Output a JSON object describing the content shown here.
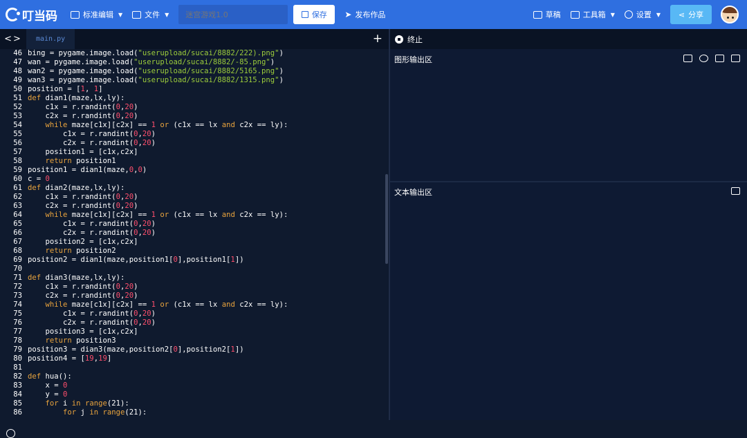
{
  "topbar": {
    "logo": "叮当码",
    "mode_menu": "标准编辑",
    "file_menu": "文件",
    "title_placeholder": "迷宫游戏1.0",
    "save": "保存",
    "publish": "发布作品",
    "draft": "草稿",
    "toolbox": "工具箱",
    "settings": "设置",
    "share": "分享"
  },
  "editor": {
    "tab": "main.py",
    "lines": [
      [
        {
          "t": "bing = pygame.image.load(",
          "c": ""
        },
        {
          "t": "\"userupload/sucai/8882/222).png\"",
          "c": "str"
        },
        {
          "t": ")",
          "c": ""
        }
      ],
      [
        {
          "t": "wan = pygame.image.load(",
          "c": ""
        },
        {
          "t": "\"userupload/sucai/8882/-85.png\"",
          "c": "str"
        },
        {
          "t": ")",
          "c": ""
        }
      ],
      [
        {
          "t": "wan2 = pygame.image.load(",
          "c": ""
        },
        {
          "t": "\"userupload/sucai/8882/5165.png\"",
          "c": "str"
        },
        {
          "t": ")",
          "c": ""
        }
      ],
      [
        {
          "t": "wan3 = pygame.image.load(",
          "c": ""
        },
        {
          "t": "\"userupload/sucai/8882/1315.png\"",
          "c": "str"
        },
        {
          "t": ")",
          "c": ""
        }
      ],
      [
        {
          "t": "position = [",
          "c": ""
        },
        {
          "t": "1",
          "c": "num"
        },
        {
          "t": ", ",
          "c": ""
        },
        {
          "t": "1",
          "c": "num"
        },
        {
          "t": "]",
          "c": ""
        }
      ],
      [
        {
          "t": "def",
          "c": "kw"
        },
        {
          "t": " dian1(maze,lx,ly):",
          "c": ""
        }
      ],
      [
        {
          "t": "    c1x = r.randint(",
          "c": ""
        },
        {
          "t": "0",
          "c": "num"
        },
        {
          "t": ",",
          "c": ""
        },
        {
          "t": "20",
          "c": "num"
        },
        {
          "t": ")",
          "c": ""
        }
      ],
      [
        {
          "t": "    c2x = r.randint(",
          "c": ""
        },
        {
          "t": "0",
          "c": "num"
        },
        {
          "t": ",",
          "c": ""
        },
        {
          "t": "20",
          "c": "num"
        },
        {
          "t": ")",
          "c": ""
        }
      ],
      [
        {
          "t": "    ",
          "c": ""
        },
        {
          "t": "while",
          "c": "kw"
        },
        {
          "t": " maze[c1x][c2x] == ",
          "c": ""
        },
        {
          "t": "1",
          "c": "num"
        },
        {
          "t": " ",
          "c": ""
        },
        {
          "t": "or",
          "c": "kw"
        },
        {
          "t": " (c1x == lx ",
          "c": ""
        },
        {
          "t": "and",
          "c": "kw"
        },
        {
          "t": " c2x == ly):",
          "c": ""
        }
      ],
      [
        {
          "t": "        c1x = r.randint(",
          "c": ""
        },
        {
          "t": "0",
          "c": "num"
        },
        {
          "t": ",",
          "c": ""
        },
        {
          "t": "20",
          "c": "num"
        },
        {
          "t": ")",
          "c": ""
        }
      ],
      [
        {
          "t": "        c2x = r.randint(",
          "c": ""
        },
        {
          "t": "0",
          "c": "num"
        },
        {
          "t": ",",
          "c": ""
        },
        {
          "t": "20",
          "c": "num"
        },
        {
          "t": ")",
          "c": ""
        }
      ],
      [
        {
          "t": "    position1 = [c1x,c2x]",
          "c": ""
        }
      ],
      [
        {
          "t": "    ",
          "c": ""
        },
        {
          "t": "return",
          "c": "kw"
        },
        {
          "t": " position1",
          "c": ""
        }
      ],
      [
        {
          "t": "position1 = dian1(maze,",
          "c": ""
        },
        {
          "t": "0",
          "c": "num"
        },
        {
          "t": ",",
          "c": ""
        },
        {
          "t": "0",
          "c": "num"
        },
        {
          "t": ")",
          "c": ""
        }
      ],
      [
        {
          "t": "c = ",
          "c": ""
        },
        {
          "t": "0",
          "c": "num"
        }
      ],
      [
        {
          "t": "def",
          "c": "kw"
        },
        {
          "t": " dian2(maze,lx,ly):",
          "c": ""
        }
      ],
      [
        {
          "t": "    c1x = r.randint(",
          "c": ""
        },
        {
          "t": "0",
          "c": "num"
        },
        {
          "t": ",",
          "c": ""
        },
        {
          "t": "20",
          "c": "num"
        },
        {
          "t": ")",
          "c": ""
        }
      ],
      [
        {
          "t": "    c2x = r.randint(",
          "c": ""
        },
        {
          "t": "0",
          "c": "num"
        },
        {
          "t": ",",
          "c": ""
        },
        {
          "t": "20",
          "c": "num"
        },
        {
          "t": ")",
          "c": ""
        }
      ],
      [
        {
          "t": "    ",
          "c": ""
        },
        {
          "t": "while",
          "c": "kw"
        },
        {
          "t": " maze[c1x][c2x] == ",
          "c": ""
        },
        {
          "t": "1",
          "c": "num"
        },
        {
          "t": " ",
          "c": ""
        },
        {
          "t": "or",
          "c": "kw"
        },
        {
          "t": " (c1x == lx ",
          "c": ""
        },
        {
          "t": "and",
          "c": "kw"
        },
        {
          "t": " c2x == ly):",
          "c": ""
        }
      ],
      [
        {
          "t": "        c1x = r.randint(",
          "c": ""
        },
        {
          "t": "0",
          "c": "num"
        },
        {
          "t": ",",
          "c": ""
        },
        {
          "t": "20",
          "c": "num"
        },
        {
          "t": ")",
          "c": ""
        }
      ],
      [
        {
          "t": "        c2x = r.randint(",
          "c": ""
        },
        {
          "t": "0",
          "c": "num"
        },
        {
          "t": ",",
          "c": ""
        },
        {
          "t": "20",
          "c": "num"
        },
        {
          "t": ")",
          "c": ""
        }
      ],
      [
        {
          "t": "    position2 = [c1x,c2x]",
          "c": ""
        }
      ],
      [
        {
          "t": "    ",
          "c": ""
        },
        {
          "t": "return",
          "c": "kw"
        },
        {
          "t": " position2",
          "c": ""
        }
      ],
      [
        {
          "t": "position2 = dian1(maze,position1[",
          "c": ""
        },
        {
          "t": "0",
          "c": "num"
        },
        {
          "t": "],position1[",
          "c": ""
        },
        {
          "t": "1",
          "c": "num"
        },
        {
          "t": "])",
          "c": ""
        }
      ],
      [],
      [
        {
          "t": "def",
          "c": "kw"
        },
        {
          "t": " dian3(maze,lx,ly):",
          "c": ""
        }
      ],
      [
        {
          "t": "    c1x = r.randint(",
          "c": ""
        },
        {
          "t": "0",
          "c": "num"
        },
        {
          "t": ",",
          "c": ""
        },
        {
          "t": "20",
          "c": "num"
        },
        {
          "t": ")",
          "c": ""
        }
      ],
      [
        {
          "t": "    c2x = r.randint(",
          "c": ""
        },
        {
          "t": "0",
          "c": "num"
        },
        {
          "t": ",",
          "c": ""
        },
        {
          "t": "20",
          "c": "num"
        },
        {
          "t": ")",
          "c": ""
        }
      ],
      [
        {
          "t": "    ",
          "c": ""
        },
        {
          "t": "while",
          "c": "kw"
        },
        {
          "t": " maze[c1x][c2x] == ",
          "c": ""
        },
        {
          "t": "1",
          "c": "num"
        },
        {
          "t": " ",
          "c": ""
        },
        {
          "t": "or",
          "c": "kw"
        },
        {
          "t": " (c1x == lx ",
          "c": ""
        },
        {
          "t": "and",
          "c": "kw"
        },
        {
          "t": " c2x == ly):",
          "c": ""
        }
      ],
      [
        {
          "t": "        c1x = r.randint(",
          "c": ""
        },
        {
          "t": "0",
          "c": "num"
        },
        {
          "t": ",",
          "c": ""
        },
        {
          "t": "20",
          "c": "num"
        },
        {
          "t": ")",
          "c": ""
        }
      ],
      [
        {
          "t": "        c2x = r.randint(",
          "c": ""
        },
        {
          "t": "0",
          "c": "num"
        },
        {
          "t": ",",
          "c": ""
        },
        {
          "t": "20",
          "c": "num"
        },
        {
          "t": ")",
          "c": ""
        }
      ],
      [
        {
          "t": "    position3 = [c1x,c2x]",
          "c": ""
        }
      ],
      [
        {
          "t": "    ",
          "c": ""
        },
        {
          "t": "return",
          "c": "kw"
        },
        {
          "t": " position3",
          "c": ""
        }
      ],
      [
        {
          "t": "position3 = dian3(maze,position2[",
          "c": ""
        },
        {
          "t": "0",
          "c": "num"
        },
        {
          "t": "],position2[",
          "c": ""
        },
        {
          "t": "1",
          "c": "num"
        },
        {
          "t": "])",
          "c": ""
        }
      ],
      [
        {
          "t": "position4 = [",
          "c": ""
        },
        {
          "t": "19",
          "c": "num"
        },
        {
          "t": ",",
          "c": ""
        },
        {
          "t": "19",
          "c": "num"
        },
        {
          "t": "]",
          "c": ""
        }
      ],
      [],
      [
        {
          "t": "def",
          "c": "kw"
        },
        {
          "t": " hua():",
          "c": ""
        }
      ],
      [
        {
          "t": "    x = ",
          "c": ""
        },
        {
          "t": "0",
          "c": "num"
        }
      ],
      [
        {
          "t": "    y = ",
          "c": ""
        },
        {
          "t": "0",
          "c": "num"
        }
      ],
      [
        {
          "t": "    ",
          "c": ""
        },
        {
          "t": "for",
          "c": "kw"
        },
        {
          "t": " i ",
          "c": ""
        },
        {
          "t": "in",
          "c": "kw"
        },
        {
          "t": " ",
          "c": ""
        },
        {
          "t": "range",
          "c": "kw"
        },
        {
          "t": "(21):",
          "c": ""
        }
      ],
      [
        {
          "t": "        ",
          "c": ""
        },
        {
          "t": "for",
          "c": "kw"
        },
        {
          "t": " j ",
          "c": ""
        },
        {
          "t": "in",
          "c": "kw"
        },
        {
          "t": " ",
          "c": ""
        },
        {
          "t": "range",
          "c": "kw"
        },
        {
          "t": "(21):",
          "c": ""
        }
      ]
    ],
    "first_line_number": 46
  },
  "output": {
    "stop": "终止",
    "graphic_title": "图形输出区",
    "text_title": "文本输出区"
  },
  "colors": {
    "topbar": "#2f6fe0",
    "editor_bg": "#0f1a2e",
    "keyword": "#e8a33d",
    "string": "#9ccc3b",
    "number": "#ff4f6d"
  }
}
